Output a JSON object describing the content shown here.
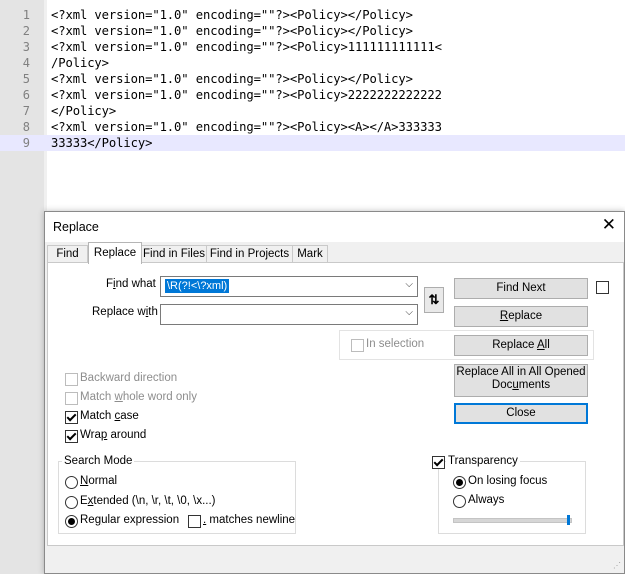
{
  "editor": {
    "lines": [
      {
        "num": "1",
        "code": "<?xml version=\"1.0\" encoding=\"\"?><Policy></Policy>"
      },
      {
        "num": "2",
        "code": "<?xml version=\"1.0\" encoding=\"\"?><Policy></Policy>"
      },
      {
        "num": "3",
        "code": "<?xml version=\"1.0\" encoding=\"\"?><Policy>111111111111<"
      },
      {
        "num": "4",
        "code": "/Policy>"
      },
      {
        "num": "5",
        "code": "<?xml version=\"1.0\" encoding=\"\"?><Policy></Policy>"
      },
      {
        "num": "6",
        "code": "<?xml version=\"1.0\" encoding=\"\"?><Policy>2222222222222"
      },
      {
        "num": "7",
        "code": "</Policy>"
      },
      {
        "num": "8",
        "code": "<?xml version=\"1.0\" encoding=\"\"?><Policy><A></A>333333"
      },
      {
        "num": "9",
        "code": "33333</Policy>"
      }
    ],
    "current_line": 9
  },
  "dialog": {
    "title": "Replace",
    "close_glyph": "✕",
    "tabs": [
      {
        "label": "Find",
        "active": false
      },
      {
        "label": "Replace",
        "active": true
      },
      {
        "label": "Find in Files",
        "active": false
      },
      {
        "label": "Find in Projects",
        "active": false
      },
      {
        "label": "Mark",
        "active": false
      }
    ],
    "find_what": {
      "label_prefix": "F",
      "label_u": "i",
      "label_rest": "nd what :",
      "value": "\\R(?!<\\?xml)"
    },
    "replace_with": {
      "label_prefix": "Replace w",
      "label_u": "i",
      "label_rest": "th :",
      "value": ""
    },
    "swap_glyph": "⇅",
    "buttons": {
      "find_next": "Find Next",
      "replace_u": "R",
      "replace_rest": "eplace",
      "replace_all_pre": "Replace ",
      "replace_all_u": "A",
      "replace_all_rest": "ll",
      "replace_all_opened_line1": "Replace All in All Opened",
      "replace_all_opened_line2_pre": "Doc",
      "replace_all_opened_line2_u": "u",
      "replace_all_opened_line2_rest": "ments",
      "close": "Close"
    },
    "in_selection": {
      "label": "In selection",
      "checked": false,
      "enabled": false
    },
    "options": {
      "backward": {
        "label": "Backward direction",
        "checked": false,
        "enabled": false
      },
      "whole_word": {
        "pre": "Match ",
        "u": "w",
        "rest": "hole word only",
        "checked": false,
        "enabled": false
      },
      "match_case": {
        "pre": "Match ",
        "u": "c",
        "rest": "ase",
        "checked": true,
        "enabled": true
      },
      "wrap_around": {
        "pre": "Wra",
        "u": "p",
        "rest": " around",
        "checked": true,
        "enabled": true
      }
    },
    "search_mode": {
      "title": "Search Mode",
      "normal": {
        "u": "N",
        "rest": "ormal",
        "selected": false
      },
      "extended": {
        "pre": "E",
        "u": "x",
        "rest": "tended (\\n, \\r, \\t, \\0, \\x...)",
        "selected": false
      },
      "regex": {
        "pre": "Re",
        "u": "g",
        "rest": "ular expression",
        "selected": true
      },
      "dot_newline": {
        "u": ".",
        "rest": " matches newline",
        "checked": false
      }
    },
    "transparency": {
      "label": "Transparency",
      "checked": true,
      "on_losing_focus": {
        "label": "On losing focus",
        "selected": true
      },
      "always": {
        "label": "Always",
        "selected": false
      },
      "level": 1.0
    }
  }
}
